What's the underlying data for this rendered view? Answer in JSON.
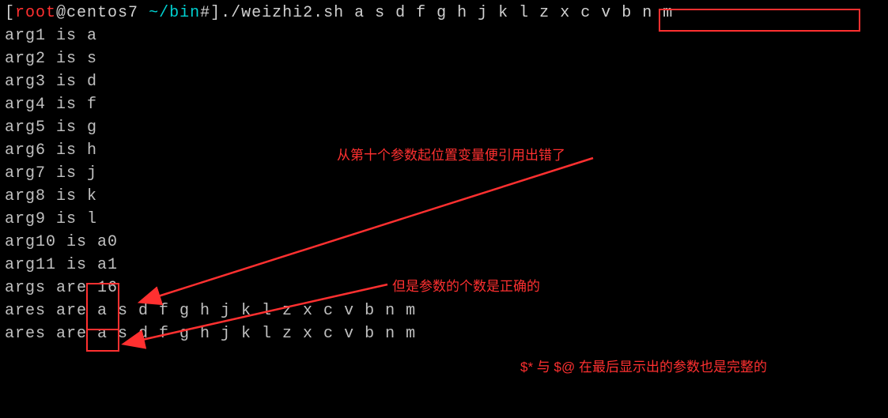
{
  "prompt": {
    "open_bracket": "[",
    "user": "root",
    "at": "@",
    "host": "centos7",
    "space": " ",
    "path": "~/bin",
    "hash": "#",
    "close_bracket": "]",
    "command": "./weizhi2.sh a s d f g h j k l z x c v b n m"
  },
  "output": [
    "arg1 is a",
    "arg2 is s",
    "arg3 is d",
    "arg4 is f",
    "arg5 is g",
    "arg6 is h",
    "arg7 is j",
    "arg8 is k",
    "arg9 is l",
    "arg10 is a0",
    "arg11 is a1",
    "args are 16",
    "ares are a s d f g h j k l z x c v b n m",
    "ares are a s d f g h j k l z x c v b n m"
  ],
  "annotations": {
    "top": "从第十个参数起位置变量便引用出错了",
    "middle": "但是参数的个数是正确的",
    "bottom": "$* 与 $@ 在最后显示出的参数也是完整的"
  },
  "chart_data": null
}
